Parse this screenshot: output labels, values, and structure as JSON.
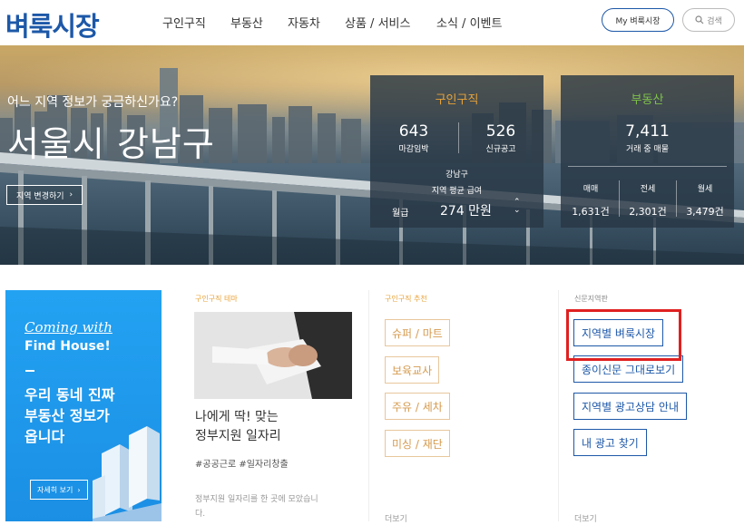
{
  "header": {
    "logo": "벼룩시장",
    "nav": [
      "구인구직",
      "부동산",
      "자동차",
      "상품 / 서비스",
      "소식 / 이벤트"
    ],
    "my_button": "My 벼룩시장",
    "search_button": "검색"
  },
  "hero": {
    "subtitle": "어느 지역 정보가 궁금하신가요?",
    "title": "서울시 강남구",
    "change_region": "지역 변경하기",
    "jobs_panel": {
      "heading": "구인구직",
      "stat1_value": "643",
      "stat1_label": "마감임박",
      "stat2_value": "526",
      "stat2_label": "신규공고",
      "region": "강남구",
      "salary_title": "지역 평균 급여",
      "salary_type": "월급",
      "salary_value": "274 만원"
    },
    "realty_panel": {
      "heading": "부동산",
      "total_value": "7,411",
      "total_label": "거래 중 매물",
      "items": [
        {
          "label": "매매",
          "value": "1,631건"
        },
        {
          "label": "전세",
          "value": "2,301건"
        },
        {
          "label": "월세",
          "value": "3,479건"
        }
      ]
    }
  },
  "banner": {
    "coming": "Coming with",
    "find": "Find House!",
    "message_lines": [
      "우리 동네 진짜",
      "부동산 정보가",
      "옵니다"
    ],
    "button": "자세히 보기"
  },
  "theme": {
    "label": "구인구직 테마",
    "title_lines": [
      "나에게 딱! 맞는",
      "정부지원 일자리"
    ],
    "tags": "#공공근로 #일자리창출",
    "desc_lines": [
      "정부지원 일자리를 한 곳에 모았습니",
      "다."
    ]
  },
  "recommend": {
    "label": "구인구직 추천",
    "items": [
      "슈퍼 / 마트",
      "보육교사",
      "주유 / 세차",
      "미싱 / 재단"
    ],
    "more": "더보기"
  },
  "newspaper": {
    "label": "신문지역판",
    "items": [
      "지역별 벼룩시장",
      "종이신문 그대로보기",
      "지역별 광고상담 안내",
      "내 광고 찾기"
    ],
    "more": "더보기"
  },
  "colors": {
    "brand": "#1d58a8",
    "jobs_accent": "#e8a33a",
    "realty_accent": "#7fc24a",
    "banner_blue": "#1b8fe4",
    "highlight_red": "#e02020"
  }
}
